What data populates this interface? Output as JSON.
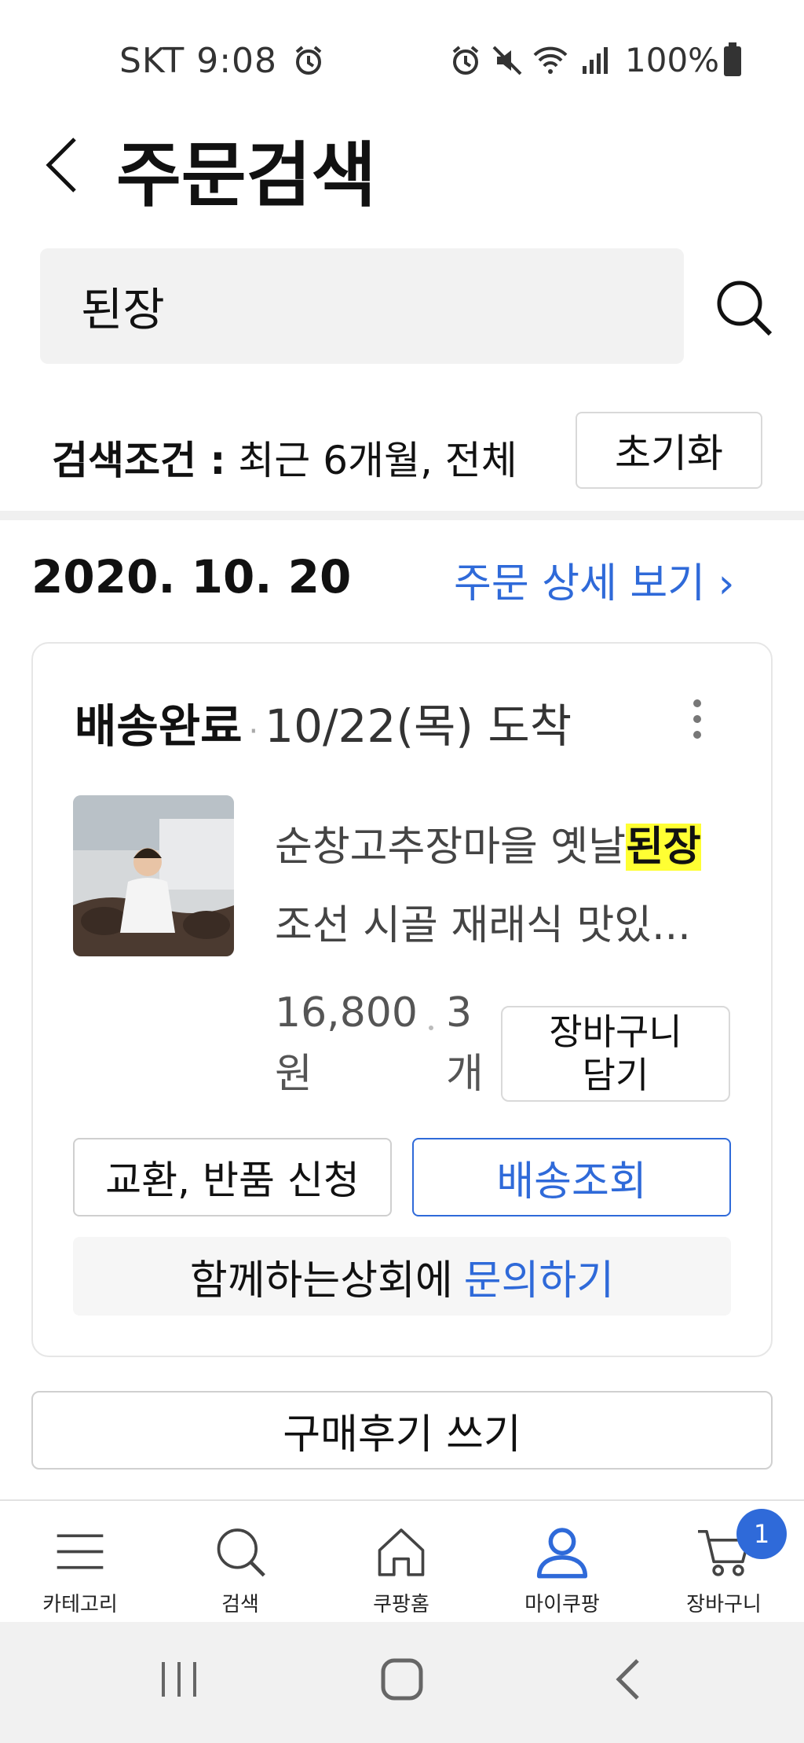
{
  "status_bar": {
    "carrier_time": "SKT 9:08",
    "battery": "100%"
  },
  "header": {
    "title": "주문검색"
  },
  "search": {
    "query": "된장"
  },
  "condition": {
    "label": "검색조건 :",
    "value": "최근 6개월, 전체",
    "reset_label": "초기화"
  },
  "order": {
    "date": "2020. 10. 20",
    "detail_link": "주문 상세 보기 ›",
    "status": "배송완료",
    "arrival": "10/22(목) 도착",
    "product_name_prefix": "순창고추장마을 옛날",
    "product_name_highlight": "된장",
    "product_name_line2": "조선 시골 재래식 맛있...",
    "price_line1": "16,800",
    "price_line2": "원",
    "qty_line1": "3",
    "qty_line2": "개",
    "cart_button_line1": "장바구니",
    "cart_button_line2": "담기",
    "exchange_button": "교환, 반품 신청",
    "track_button": "배송조회",
    "inquiry_text": "함께하는상회에",
    "inquiry_link": "문의하기"
  },
  "review_button": "구매후기 쓰기",
  "bottom_nav": {
    "items": [
      {
        "label": "카테고리",
        "icon": "menu-icon"
      },
      {
        "label": "검색",
        "icon": "search-icon"
      },
      {
        "label": "쿠팡홈",
        "icon": "home-icon"
      },
      {
        "label": "마이쿠팡",
        "icon": "user-icon"
      },
      {
        "label": "장바구니",
        "icon": "cart-icon"
      }
    ],
    "cart_badge": "1"
  },
  "colors": {
    "accent": "#2f6ad9",
    "highlight": "#ffff33"
  }
}
